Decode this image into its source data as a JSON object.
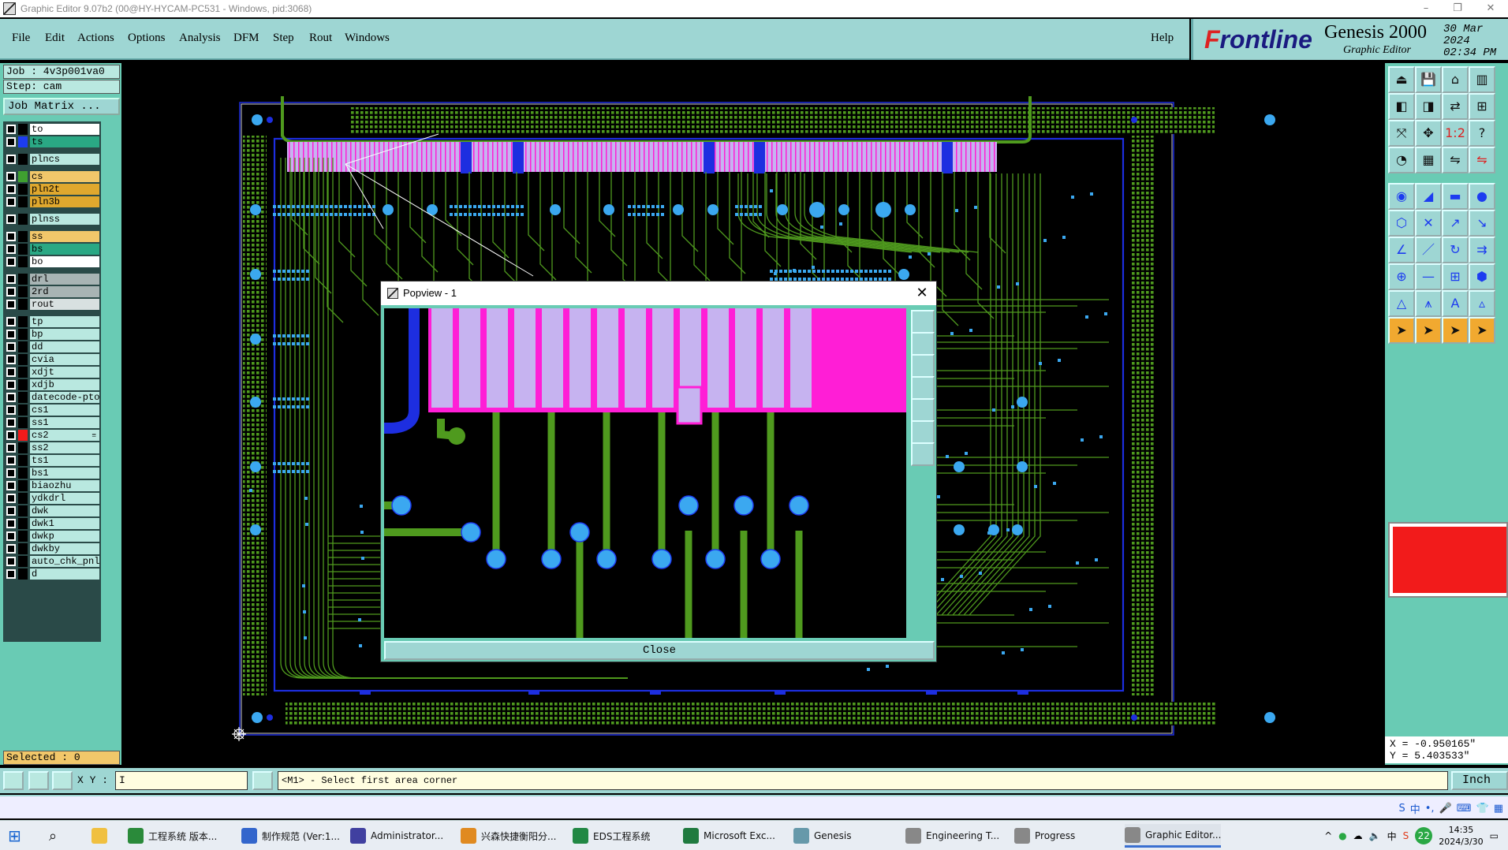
{
  "window": {
    "title": "Graphic Editor 9.07b2 (00@HY-HYCAM-PC531 - Windows, pid:3068)",
    "controls": [
      "–",
      "❐",
      "✕"
    ]
  },
  "menu": {
    "items": [
      "File",
      "Edit",
      "Actions",
      "Options",
      "Analysis",
      "DFM",
      "Step",
      "Rout",
      "Windows"
    ],
    "help": "Help"
  },
  "brand": {
    "logo_f": "F",
    "logo_rest": "rontline",
    "product": "Genesis 2000",
    "subtitle": "Graphic Editor",
    "date": "30 Mar 2024",
    "time": "02:34 PM"
  },
  "job": {
    "job": "Job : 4v3p001va0",
    "step": "Step: cam",
    "matrix_button": "Job Matrix ..."
  },
  "layers": [
    {
      "name": "to",
      "swatch": "#000000",
      "bg": "#ffffff",
      "group": 1
    },
    {
      "name": "ts",
      "swatch": "#1d3cf0",
      "bg": "#2aa884",
      "group": 1
    },
    {
      "name": "plncs",
      "swatch": "#000000",
      "bg": "#b9e8e0",
      "group": 2
    },
    {
      "name": "cs",
      "swatch": "#3fa030",
      "bg": "#f1c76a",
      "group": 3
    },
    {
      "name": "pln2t",
      "swatch": "#000000",
      "bg": "#e0a82e",
      "group": 3
    },
    {
      "name": "pln3b",
      "swatch": "#000000",
      "bg": "#e0a82e",
      "group": 3
    },
    {
      "name": "plnss",
      "swatch": "#000000",
      "bg": "#b9e8e0",
      "group": 4
    },
    {
      "name": "ss",
      "swatch": "#000000",
      "bg": "#f1c76a",
      "group": 5
    },
    {
      "name": "bs",
      "swatch": "#000000",
      "bg": "#2aa884",
      "group": 5
    },
    {
      "name": "bo",
      "swatch": "#000000",
      "bg": "#ffffff",
      "group": 5
    },
    {
      "name": "drl",
      "swatch": "#000000",
      "bg": "#a8b4b4",
      "group": 6
    },
    {
      "name": "2rd",
      "swatch": "#000000",
      "bg": "#a8b4b4",
      "group": 6
    },
    {
      "name": "rout",
      "swatch": "#000000",
      "bg": "#d8e0e0",
      "group": 6
    },
    {
      "name": "tp",
      "swatch": "#000000",
      "bg": "#b9e8e0",
      "group": 7
    },
    {
      "name": "bp",
      "swatch": "#000000",
      "bg": "#b9e8e0",
      "group": 7
    },
    {
      "name": "dd",
      "swatch": "#000000",
      "bg": "#b9e8e0",
      "group": 7
    },
    {
      "name": "cvia",
      "swatch": "#000000",
      "bg": "#b9e8e0",
      "group": 7
    },
    {
      "name": "xdjt",
      "swatch": "#000000",
      "bg": "#b9e8e0",
      "group": 7
    },
    {
      "name": "xdjb",
      "swatch": "#000000",
      "bg": "#b9e8e0",
      "group": 7
    },
    {
      "name": "datecode-pto",
      "swatch": "#000000",
      "bg": "#b9e8e0",
      "group": 7
    },
    {
      "name": "cs1",
      "swatch": "#000000",
      "bg": "#b9e8e0",
      "group": 7
    },
    {
      "name": "ss1",
      "swatch": "#000000",
      "bg": "#b9e8e0",
      "group": 7
    },
    {
      "name": "cs2",
      "swatch": "#f21b1b",
      "bg": "#b9e8e0",
      "group": 7,
      "mark": "≡"
    },
    {
      "name": "ss2",
      "swatch": "#000000",
      "bg": "#b9e8e0",
      "group": 7
    },
    {
      "name": "ts1",
      "swatch": "#000000",
      "bg": "#b9e8e0",
      "group": 7
    },
    {
      "name": "bs1",
      "swatch": "#000000",
      "bg": "#b9e8e0",
      "group": 7
    },
    {
      "name": "biaozhu",
      "swatch": "#000000",
      "bg": "#b9e8e0",
      "group": 7
    },
    {
      "name": "ydkdrl",
      "swatch": "#000000",
      "bg": "#b9e8e0",
      "group": 7
    },
    {
      "name": "dwk",
      "swatch": "#000000",
      "bg": "#b9e8e0",
      "group": 7
    },
    {
      "name": "dwk1",
      "swatch": "#000000",
      "bg": "#b9e8e0",
      "group": 7
    },
    {
      "name": "dwkp",
      "swatch": "#000000",
      "bg": "#b9e8e0",
      "group": 7
    },
    {
      "name": "dwkby",
      "swatch": "#000000",
      "bg": "#b9e8e0",
      "group": 7
    },
    {
      "name": "auto_chk_pnl",
      "swatch": "#000000",
      "bg": "#b9e8e0",
      "group": 7
    },
    {
      "name": "d",
      "swatch": "#000000",
      "bg": "#b9e8e0",
      "group": 7
    }
  ],
  "selected": "Selected : 0",
  "popview": {
    "title": "Popview - 1",
    "close_label": "Close",
    "close_icon": "✕"
  },
  "coords": {
    "x": "X = -0.950165\"",
    "y": "Y = 5.403533\""
  },
  "colors": {
    "current_layer": "#f21b1b",
    "copper": "#4f9a1e",
    "pad": "#3ba8f0",
    "mask": "#c6b3f0",
    "mask_edge": "#ff1ed6",
    "outline": "#1d2ee0"
  },
  "cmd": {
    "xy_label": "X Y :",
    "xy_value": "I",
    "prompt": "<M1> - Select first area corner",
    "unit": "Inch"
  },
  "taskbar": {
    "items": [
      {
        "label": "工程系统  版本...",
        "icon": "#2a8a3a"
      },
      {
        "label": "制作规范 (Ver:1...",
        "icon": "#3366cc"
      },
      {
        "label": "Administrator...",
        "icon": "#4040a0"
      },
      {
        "label": "兴森快捷衡阳分...",
        "icon": "#e08a20"
      },
      {
        "label": "EDS工程系统",
        "icon": "#228844"
      },
      {
        "label": "Microsoft Exc...",
        "icon": "#1f7a3f"
      },
      {
        "label": "Genesis",
        "icon": "#6699aa"
      },
      {
        "label": "Engineering T...",
        "icon": "#888888"
      },
      {
        "label": "Progress",
        "icon": "#888888"
      },
      {
        "label": "Graphic Editor...",
        "icon": "#888888"
      }
    ],
    "tray_badge": "22",
    "ime": "中",
    "time": "14:35",
    "date": "2024/3/30"
  }
}
